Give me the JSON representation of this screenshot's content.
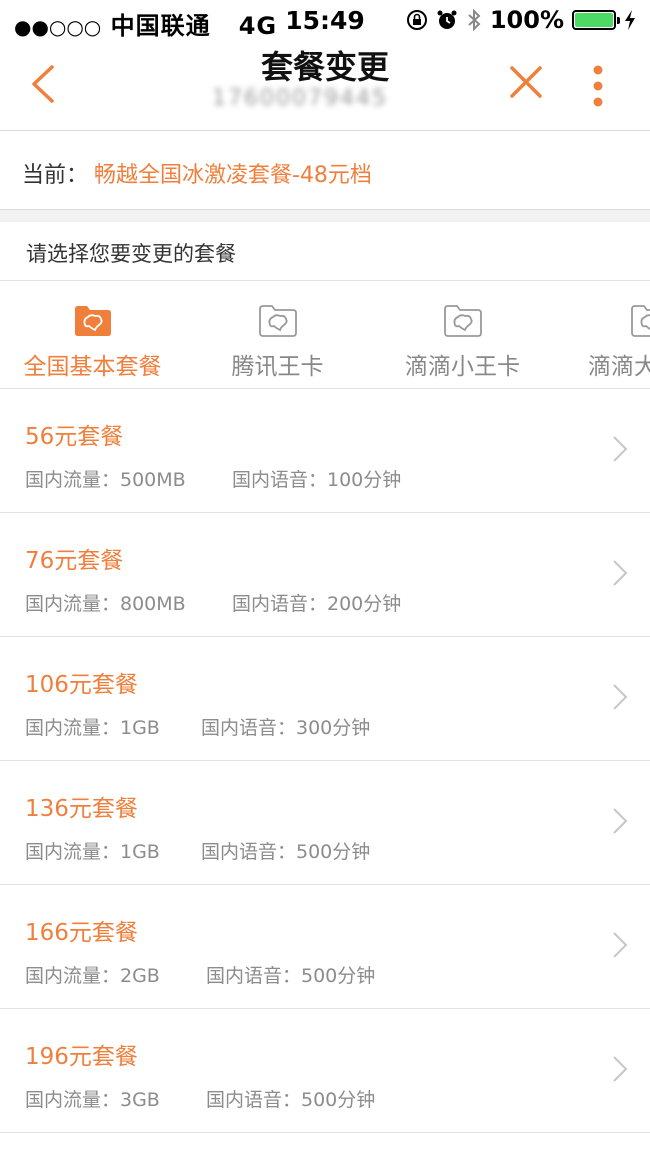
{
  "status_bar": {
    "signal": "●●○○○",
    "carrier": "中国联通",
    "network": "4G",
    "time": "15:49",
    "battery": "100%"
  },
  "nav": {
    "title": "套餐变更",
    "subtitle": "17600079445"
  },
  "current_plan": {
    "label": "当前：",
    "value": "畅越全国冰激凌套餐-48元档"
  },
  "section_title": "请选择您要变更的套餐",
  "tabs": [
    {
      "label": "全国基本套餐",
      "active": true
    },
    {
      "label": "腾讯王卡",
      "active": false
    },
    {
      "label": "滴滴小王卡",
      "active": false
    },
    {
      "label": "滴滴大王卡",
      "active": false
    }
  ],
  "plans": [
    {
      "name": "56元套餐",
      "data": "国内流量：500MB",
      "voice": "国内语音：100分钟"
    },
    {
      "name": "76元套餐",
      "data": "国内流量：800MB",
      "voice": "国内语音：200分钟"
    },
    {
      "name": "106元套餐",
      "data": "国内流量：1GB",
      "voice": "国内语音：300分钟"
    },
    {
      "name": "136元套餐",
      "data": "国内流量：1GB",
      "voice": "国内语音：500分钟"
    },
    {
      "name": "166元套餐",
      "data": "国内流量：2GB",
      "voice": "国内语音：500分钟"
    },
    {
      "name": "196元套餐",
      "data": "国内流量：3GB",
      "voice": "国内语音：500分钟"
    }
  ],
  "colors": {
    "accent": "#f07f3c",
    "muted": "#8c8c8c",
    "battery": "#4cd964"
  }
}
